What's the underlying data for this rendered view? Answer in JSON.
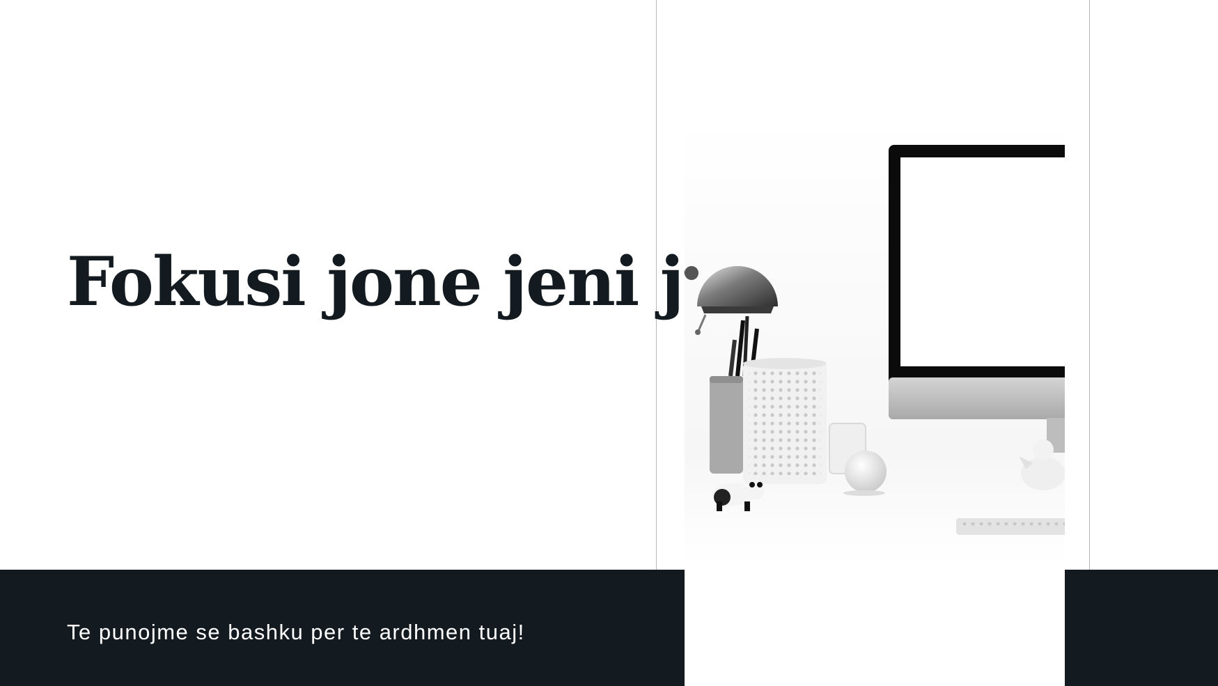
{
  "slide": {
    "title": "Fokusi jone jeni ju",
    "subtitle": "Te punojme se bashku per te ardhmen tuaj!"
  },
  "photo": {
    "description_icon": "desk-workspace-image",
    "colors": {
      "dark": "#131b20",
      "accent_gray": "#b8b8b8"
    }
  }
}
